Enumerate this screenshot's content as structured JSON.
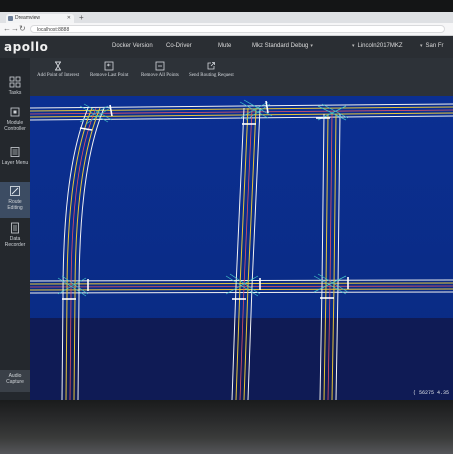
{
  "browser": {
    "tab_title": "Dreamview",
    "url": "localhost:8888"
  },
  "header": {
    "logo": "apollo",
    "items": [
      {
        "label": "Docker Version",
        "dropdown": false
      },
      {
        "label": "Co-Driver",
        "dropdown": false
      },
      {
        "label": "Mute",
        "dropdown": false
      },
      {
        "label": "Mkz Standard Debug",
        "dropdown": true
      },
      {
        "label": "Lincoln2017MKZ",
        "dropdown": true
      },
      {
        "label": "San Fr",
        "dropdown": true
      }
    ]
  },
  "sidebar": {
    "items": [
      {
        "label": "Tasks",
        "icon": "tasks-grid-icon",
        "active": false
      },
      {
        "label": "Module Controller",
        "icon": "module-controller-icon",
        "active": false
      },
      {
        "label": "Layer Menu",
        "icon": "layer-menu-icon",
        "active": false
      },
      {
        "label": "Route Editing",
        "icon": "route-editing-icon",
        "active": true
      },
      {
        "label": "Data Recorder",
        "icon": "data-recorder-icon",
        "active": false
      }
    ],
    "audio_capture": "Audio Capture"
  },
  "tools": [
    {
      "label": "Add Point of Interest",
      "icon": "hourglass-icon"
    },
    {
      "label": "Remove Last Point",
      "icon": "undo-icon"
    },
    {
      "label": "Remove All Points",
      "icon": "remove-all-icon"
    },
    {
      "label": "Send Routing Request",
      "icon": "send-icon"
    }
  ],
  "map": {
    "coords": "( 56275 4.35",
    "colors": {
      "sky": "#0a2d8c",
      "ground": "#101a52",
      "lane_white": "#f2f2f2",
      "lane_yellow": "#e7c63a",
      "lane_red": "#e05565",
      "junction": "#43c6c9"
    }
  }
}
